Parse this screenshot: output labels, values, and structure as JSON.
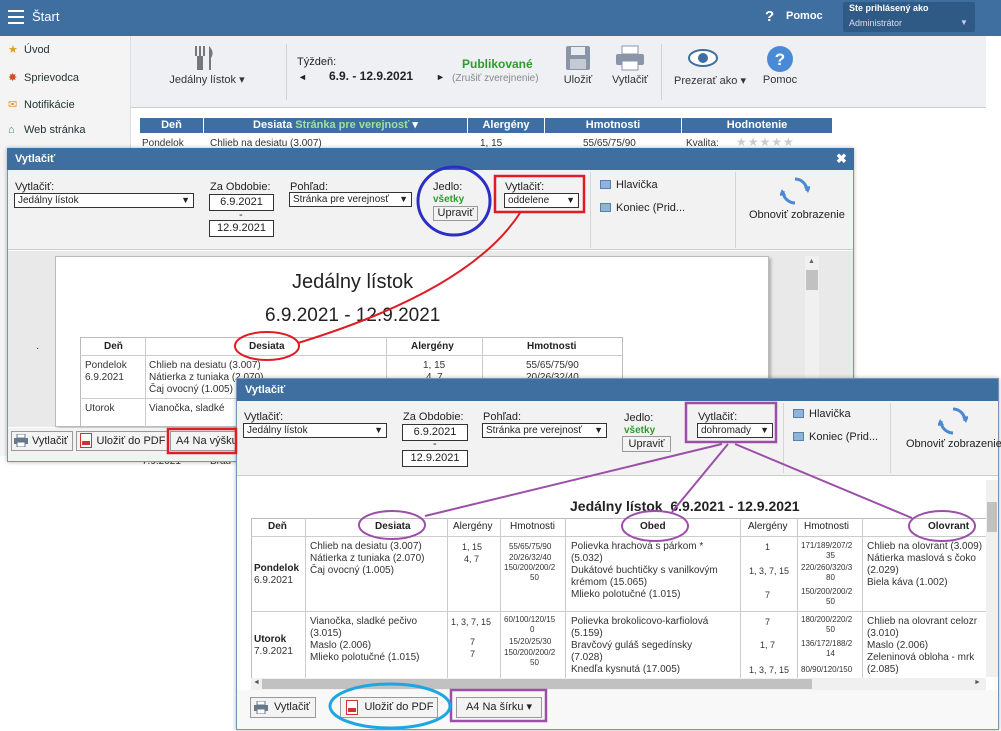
{
  "app": {
    "title": "Štart",
    "help": "Pomoc",
    "user_label": "Ste prihlásený ako",
    "user_name": "Administrátor"
  },
  "sidebar": {
    "items": [
      {
        "label": "Úvod",
        "icon": "star-icon"
      },
      {
        "label": "Sprievodca",
        "icon": "wand-icon"
      },
      {
        "label": "Notifikácie",
        "icon": "envelope-icon"
      },
      {
        "label": "Web stránka",
        "icon": "home-icon"
      }
    ]
  },
  "toolbar": {
    "menu_label": "Jedálny lístok",
    "week_label": "Týždeň:",
    "week_range": "6.9. - 12.9.2021",
    "prev": "◄",
    "next": "►",
    "status": "Publikované",
    "unpublish": "(Zrušiť zverejnenie)",
    "save": "Uložiť",
    "print": "Vytlačiť",
    "view_as": "Prezerať ako",
    "help": "Pomoc"
  },
  "bg_table": {
    "headers": [
      "Deň",
      "Desiata",
      "Stránka pre verejnosť",
      "Alergény",
      "Hmotnosti",
      "Hodnotenie"
    ],
    "row_day": "Pondelok",
    "row_food": "Chlieb na desiatu (3.007)",
    "row_allergen": "1, 15",
    "row_weight": "55/65/75/90",
    "row_quality": "Kvalita:",
    "row2_day": "7.9.2021",
    "row2_food": "Brau"
  },
  "dialog1": {
    "title": "Vytlačiť",
    "print_label": "Vytlačiť:",
    "print_value": "Jedálny lístok",
    "period_label": "Za Obdobie:",
    "date_from": "6.9.2021",
    "dash": "-",
    "date_to": "12.9.2021",
    "view_label": "Pohľad:",
    "view_value": "Stránka pre verejnosť",
    "meal_label": "Jedlo:",
    "meal_value": "všetky",
    "edit": "Upraviť",
    "print2_label": "Vytlačiť:",
    "print2_value": "oddelene",
    "header_opt": "Hlavička",
    "footer_opt": "Koniec (Prid...",
    "refresh": "Obnoviť zobrazenie",
    "doc_title": "Jedálny lístok",
    "doc_range": "6.9.2021 - 12.9.2021",
    "col_day": "Deň",
    "col_desiata": "Desiata",
    "col_allergens": "Alergény",
    "col_weights": "Hmotnosti",
    "r1_day": "Pondelok",
    "r1_date": "6.9.2021",
    "r1_f1": "Chlieb na desiatu (3.007)",
    "r1_f2": "Nátierka z tuniaka (2.070)",
    "r1_f3": "Čaj ovocný (1.005)",
    "r1_a1": "1, 15",
    "r1_a2": "4, 7",
    "r1_w1": "55/65/75/90",
    "r1_w2": "20/26/32/40",
    "r2_day": "Utorok",
    "r2_f1": "Vianočka, sladké",
    "btn_print": "Vytlačiť",
    "btn_pdf": "Uložiť do PDF",
    "btn_format": "A4 Na výšku"
  },
  "dialog2": {
    "title": "Vytlačiť",
    "print_label": "Vytlačiť:",
    "print_value": "Jedálny lístok",
    "period_label": "Za Obdobie:",
    "date_from": "6.9.2021",
    "dash": "-",
    "date_to": "12.9.2021",
    "view_label": "Pohľad:",
    "view_value": "Stránka pre verejnosť",
    "meal_label": "Jedlo:",
    "meal_value": "všetky",
    "edit": "Upraviť",
    "print2_label": "Vytlačiť:",
    "print2_value": "dohromady",
    "header_opt": "Hlavička",
    "footer_opt": "Koniec (Prid...",
    "refresh": "Obnoviť zobrazenie",
    "doc_title": "Jedálny lístok  6.9.2021 - 12.9.2021",
    "columns": [
      "Deň",
      "Desiata",
      "Alergény",
      "Hmotnosti",
      "Obed",
      "Alergény",
      "Hmotnosti",
      "Olovrant"
    ],
    "row1": {
      "day": "Pondelok",
      "date": "6.9.2021",
      "desiata": [
        "Chlieb na desiatu (3.007)",
        "Nátierka z tuniaka (2.070)",
        "Čaj ovocný (1.005)"
      ],
      "d_alg": [
        "1, 15",
        "4, 7"
      ],
      "d_w": [
        "55/65/75/90",
        "20/26/32/40",
        "150/200/200/2",
        "50"
      ],
      "obed": [
        "Polievka hrachová s párkom *",
        "(5.032)",
        "Dukátové buchtičky s vanilkovým",
        "krémom (15.065)",
        "Mlieko polotučné (1.015)"
      ],
      "o_alg": [
        "1",
        "1, 3, 7, 15",
        "7"
      ],
      "o_w": [
        "171/189/207/2",
        "35",
        "220/260/320/3",
        "80",
        "150/200/200/2",
        "50"
      ],
      "olovrant": [
        "Chlieb na olovrant (3.009)",
        "Nátierka maslová s čoko",
        "(2.029)",
        "Biela káva (1.002)"
      ]
    },
    "row2": {
      "day": "Utorok",
      "date": "7.9.2021",
      "desiata": [
        "Vianočka, sladké pečivo",
        "(3.015)",
        "Maslo (2.006)",
        "Mlieko polotučné (1.015)"
      ],
      "d_alg": [
        "1, 3, 7, 15",
        "7",
        "7"
      ],
      "d_w": [
        "60/100/120/15",
        "0",
        "15/20/25/30",
        "150/200/200/2",
        "50"
      ],
      "obed": [
        "Polievka brokolicovo-karfiolová",
        "(5.159)",
        "Bravčový guláš segedínsky",
        "(7.028)",
        "Knedľa kysnutá (17.005)"
      ],
      "o_alg": [
        "7",
        "1, 7",
        "1, 3, 7, 15"
      ],
      "o_w": [
        "180/200/220/2",
        "50",
        "136/172/188/2",
        "14",
        "80/90/120/150"
      ],
      "olovrant": [
        "Chlieb na olovrant celozr",
        "(3.010)",
        "Maslo (2.006)",
        "Zeleninová obloha - mrk",
        "(2.085)"
      ]
    },
    "btn_print": "Vytlačiť",
    "btn_pdf": "Uložiť do PDF",
    "btn_format": "A4 Na šírku"
  },
  "colors": {
    "header_blue": "#3f6fa0",
    "green": "#2f9b2f",
    "red": "#e01b24",
    "blue": "#2b2fc7",
    "purple": "#9b4fa8",
    "cyan": "#1ea6e0"
  }
}
